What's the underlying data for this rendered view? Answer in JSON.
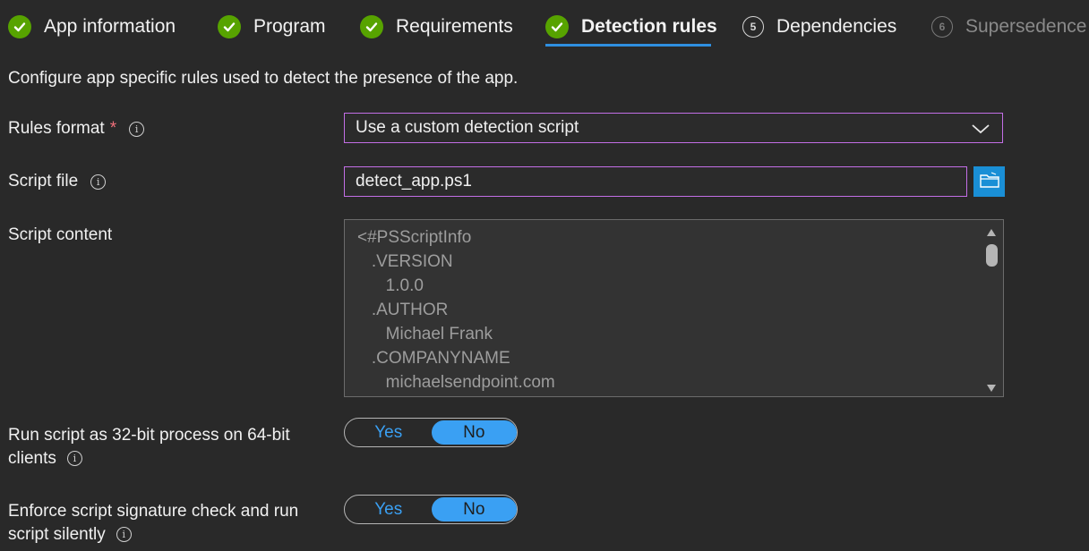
{
  "wizard": {
    "steps": [
      {
        "label": "App information",
        "state": "complete"
      },
      {
        "label": "Program",
        "state": "complete"
      },
      {
        "label": "Requirements",
        "state": "complete"
      },
      {
        "label": "Detection rules",
        "state": "active"
      },
      {
        "label": "Dependencies",
        "state": "pending",
        "number": "5"
      },
      {
        "label": "Supersedence",
        "state": "disabled",
        "number": "6"
      }
    ]
  },
  "description": "Configure app specific rules used to detect the presence of the app.",
  "rules_format": {
    "label": "Rules format",
    "required_mark": "*",
    "value": "Use a custom detection script"
  },
  "script_file": {
    "label": "Script file",
    "value": "detect_app.ps1"
  },
  "script_content": {
    "label": "Script content",
    "lines": [
      "<#PSScriptInfo",
      "   .VERSION",
      "      1.0.0",
      "   .AUTHOR",
      "      Michael Frank",
      "   .COMPANYNAME",
      "      michaelsendpoint.com"
    ]
  },
  "run_32bit": {
    "label_line1": "Run script as 32-bit process on 64-bit",
    "label_line2": "clients",
    "yes": "Yes",
    "no": "No",
    "selected": "No"
  },
  "enforce_signature": {
    "label_line1": "Enforce script signature check and run",
    "label_line2": "script silently",
    "yes": "Yes",
    "no": "No",
    "selected": "No"
  },
  "icons": {
    "info": "info-icon",
    "check": "checkmark-icon",
    "chevron": "chevron-down-icon",
    "browse": "folder-icon"
  },
  "colors": {
    "background": "#292929",
    "accent": "#3aa0f3",
    "complete": "#57a300",
    "focus_border": "#c36ee6",
    "required": "#f1707b"
  }
}
